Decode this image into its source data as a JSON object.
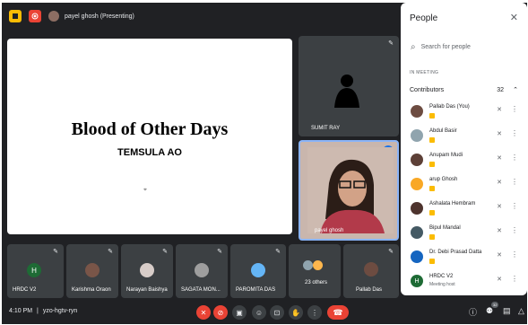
{
  "topbar": {
    "presenting_text": "payel ghosh (Presenting)",
    "colors": {
      "slide_icon": "#fbbc04",
      "record_icon": "#ea4335"
    }
  },
  "slide": {
    "title": "Blood of Other Days",
    "author": "TEMSULA AO"
  },
  "tiles": {
    "right_top_name": "SUMIT RAY",
    "active_speaker_name": "payel ghosh",
    "bottom": [
      {
        "name": "HRDC V2",
        "avatar_letter": "H"
      },
      {
        "name": "Karishma Oraon"
      },
      {
        "name": "Narayan Baishya"
      },
      {
        "name": "SAGATA MON..."
      },
      {
        "name": "PAROMITA DAS"
      },
      {
        "name": "23 others"
      },
      {
        "name": "Pallab Das"
      }
    ]
  },
  "people_panel": {
    "title": "People",
    "search_placeholder": "Search for people",
    "section_label": "IN MEETING",
    "contributors_label": "Contributors",
    "contributors_count": "32",
    "participants": [
      {
        "name": "Pallab Das (You)",
        "avatar_color": "#6d4c41"
      },
      {
        "name": "Abdul Basir",
        "avatar_color": "#90a4ae"
      },
      {
        "name": "Anupam Mudi",
        "avatar_color": "#5d4037"
      },
      {
        "name": "arup Ghosh",
        "avatar_color": "#f9a825"
      },
      {
        "name": "Ashalata Hembram",
        "avatar_color": "#4e342e"
      },
      {
        "name": "Bipul Mandal",
        "avatar_color": "#455a64"
      },
      {
        "name": "Dr. Debi Prasad Datta",
        "avatar_color": "#1565c0"
      },
      {
        "name": "HRDC V2",
        "sub": "Meeting host",
        "avatar_letter": "H",
        "avatar_color": "#1e6b35"
      }
    ]
  },
  "bottombar": {
    "time": "4:10 PM",
    "separator": "|",
    "meeting_code": "yzo-hgtv-ryn",
    "people_badge": "32"
  }
}
